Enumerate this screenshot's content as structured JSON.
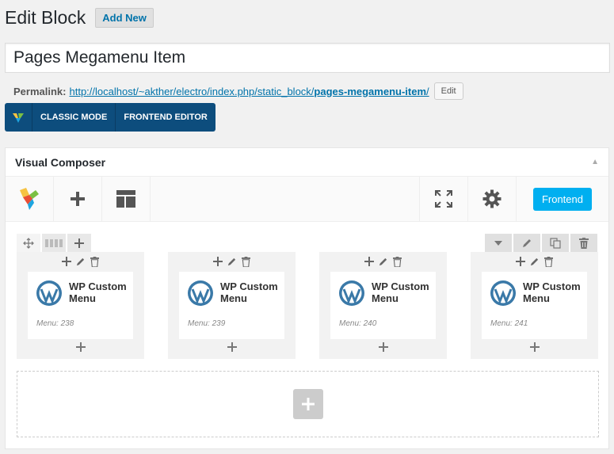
{
  "header": {
    "title": "Edit Block",
    "add_new": "Add New"
  },
  "post_title": "Pages Megamenu Item",
  "permalink": {
    "label": "Permalink:",
    "url_base": "http://localhost/~akther/electro/index.php/static_block/",
    "slug": "pages-megamenu-item",
    "trailing": "/",
    "edit": "Edit"
  },
  "mode_bar": {
    "classic": "CLASSIC MODE",
    "frontend_editor": "FRONTEND EDITOR"
  },
  "vc": {
    "title": "Visual Composer",
    "frontend_button": "Frontend",
    "icons": [
      "vc-logo-icon",
      "plus-icon",
      "templates-icon",
      "fullscreen-icon",
      "gear-icon"
    ]
  },
  "columns": [
    {
      "name": "WP Custom Menu",
      "menu": "Menu: 238"
    },
    {
      "name": "WP Custom Menu",
      "menu": "Menu: 239"
    },
    {
      "name": "WP Custom Menu",
      "menu": "Menu: 240"
    },
    {
      "name": "WP Custom Menu",
      "menu": "Menu: 241"
    }
  ],
  "colors": {
    "accent": "#0073aa",
    "frontend": "#00aff0",
    "mode_bar": "#0d4d7d",
    "wp_blue": "#3a79a8"
  }
}
